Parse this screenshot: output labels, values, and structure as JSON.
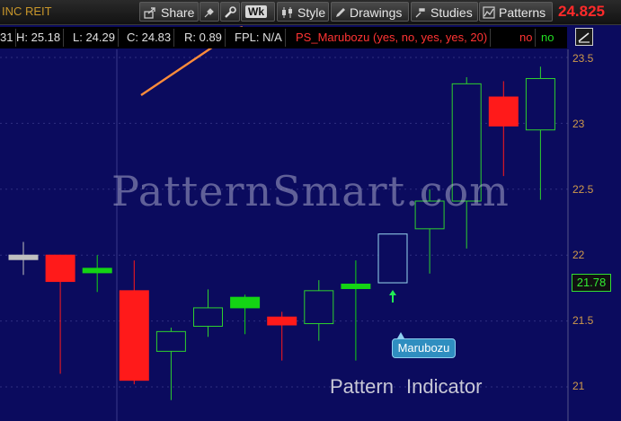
{
  "toolbar": {
    "symbol_title": "INC REIT",
    "share_label": "Share",
    "aggregation_label": "Wk",
    "style_label": "Style",
    "drawings_label": "Drawings",
    "studies_label": "Studies",
    "patterns_label": "Patterns",
    "last_price": "24.825"
  },
  "info_bar": {
    "open_label": "31",
    "high_label": "H: 25.18",
    "low_label": "L: 24.29",
    "close_label": "C: 24.83",
    "range_label": "R: 0.89",
    "fpl_label": "FPL: N/A",
    "study_label": "PS_Marubozu (yes, no, yes, yes, 20)",
    "flag_no_1": "no",
    "flag_no_2": "no"
  },
  "overlay": {
    "watermark": "PatternSmart.com",
    "pattern_indicator": "Pattern  Indicator",
    "marubozu_tag": "Marubozu"
  },
  "price_axis": {
    "ticks": [
      "23.5",
      "23",
      "22.5",
      "22",
      "21.5",
      "21"
    ],
    "last_price_box": "21.78"
  },
  "colors": {
    "background": "#0b0b5e",
    "up_filled": "#14d414",
    "down_filled": "#ff1a1a",
    "doji": "#c0c0c0",
    "hollow_up": "#2ed12e",
    "highlight": "#9ad8f0",
    "arrow": "#ff8c3a"
  },
  "chart_data": {
    "type": "candlestick",
    "y_axis_range": [
      20.95,
      23.55
    ],
    "y_ticks": [
      21,
      21.5,
      22,
      22.5,
      23,
      23.5
    ],
    "bars": [
      {
        "o": 22.0,
        "h": 22.1,
        "l": 21.85,
        "c": 22.0,
        "style": "doji"
      },
      {
        "o": 22.0,
        "h": 22.0,
        "l": 21.1,
        "c": 21.8,
        "style": "down"
      },
      {
        "o": 21.9,
        "h": 22.0,
        "l": 21.72,
        "c": 21.88,
        "style": "up"
      },
      {
        "o": 21.73,
        "h": 21.96,
        "l": 21.02,
        "c": 21.05,
        "style": "down"
      },
      {
        "o": 21.27,
        "h": 21.45,
        "l": 20.9,
        "c": 21.42,
        "style": "hollow"
      },
      {
        "o": 21.46,
        "h": 21.74,
        "l": 21.38,
        "c": 21.6,
        "style": "hollow"
      },
      {
        "o": 21.6,
        "h": 21.7,
        "l": 21.4,
        "c": 21.68,
        "style": "up"
      },
      {
        "o": 21.53,
        "h": 21.57,
        "l": 21.2,
        "c": 21.47,
        "style": "down"
      },
      {
        "o": 21.48,
        "h": 21.81,
        "l": 21.35,
        "c": 21.73,
        "style": "hollow"
      },
      {
        "o": 21.76,
        "h": 21.96,
        "l": 21.2,
        "c": 21.78,
        "style": "up"
      },
      {
        "o": 21.79,
        "h": 22.16,
        "l": 21.79,
        "c": 22.16,
        "style": "highlight",
        "marked": true
      },
      {
        "o": 22.2,
        "h": 22.5,
        "l": 21.86,
        "c": 22.41,
        "style": "hollow"
      },
      {
        "o": 22.41,
        "h": 23.35,
        "l": 22.05,
        "c": 23.3,
        "style": "hollow"
      },
      {
        "o": 23.2,
        "h": 23.32,
        "l": 22.6,
        "c": 22.98,
        "style": "down"
      },
      {
        "o": 22.95,
        "h": 23.43,
        "l": 22.42,
        "c": 23.34,
        "style": "hollow"
      }
    ]
  }
}
